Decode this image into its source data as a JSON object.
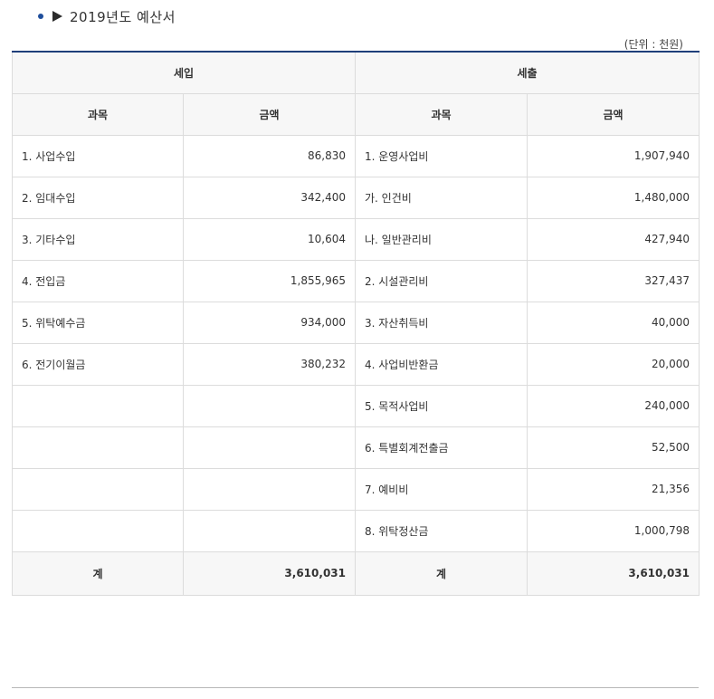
{
  "page": {
    "title": "2019년도 예산서",
    "unit": "(단위 : 천원)"
  },
  "table": {
    "headers": {
      "revenue": "세입",
      "expenditure": "세출",
      "item": "과목",
      "amount": "금액"
    },
    "rows": [
      {
        "rev_item": "1. 사업수입",
        "rev_amount": "86,830",
        "exp_item": "1. 운영사업비",
        "exp_amount": "1,907,940"
      },
      {
        "rev_item": "2. 임대수입",
        "rev_amount": "342,400",
        "exp_item": "가. 인건비",
        "exp_amount": "1,480,000"
      },
      {
        "rev_item": "3. 기타수입",
        "rev_amount": "10,604",
        "exp_item": "나. 일반관리비",
        "exp_amount": "427,940"
      },
      {
        "rev_item": "4. 전입금",
        "rev_amount": "1,855,965",
        "exp_item": "2. 시설관리비",
        "exp_amount": "327,437"
      },
      {
        "rev_item": "5. 위탁예수금",
        "rev_amount": "934,000",
        "exp_item": "3. 자산취득비",
        "exp_amount": "40,000"
      },
      {
        "rev_item": "6. 전기이월금",
        "rev_amount": "380,232",
        "exp_item": "4. 사업비반환금",
        "exp_amount": "20,000"
      },
      {
        "rev_item": "",
        "rev_amount": "",
        "exp_item": "5. 목적사업비",
        "exp_amount": "240,000"
      },
      {
        "rev_item": "",
        "rev_amount": "",
        "exp_item": "6. 특별회계전출금",
        "exp_amount": "52,500"
      },
      {
        "rev_item": "",
        "rev_amount": "",
        "exp_item": "7. 예비비",
        "exp_amount": "21,356"
      },
      {
        "rev_item": "",
        "rev_amount": "",
        "exp_item": "8. 위탁정산금",
        "exp_amount": "1,000,798"
      }
    ],
    "total": {
      "rev_label": "계",
      "rev_amount": "3,610,031",
      "exp_label": "계",
      "exp_amount": "3,610,031"
    }
  },
  "colors": {
    "accent": "#1f3f7a",
    "bullet": "#1f4e9c",
    "header_bg": "#f7f7f7",
    "border": "#dcdcdc"
  }
}
